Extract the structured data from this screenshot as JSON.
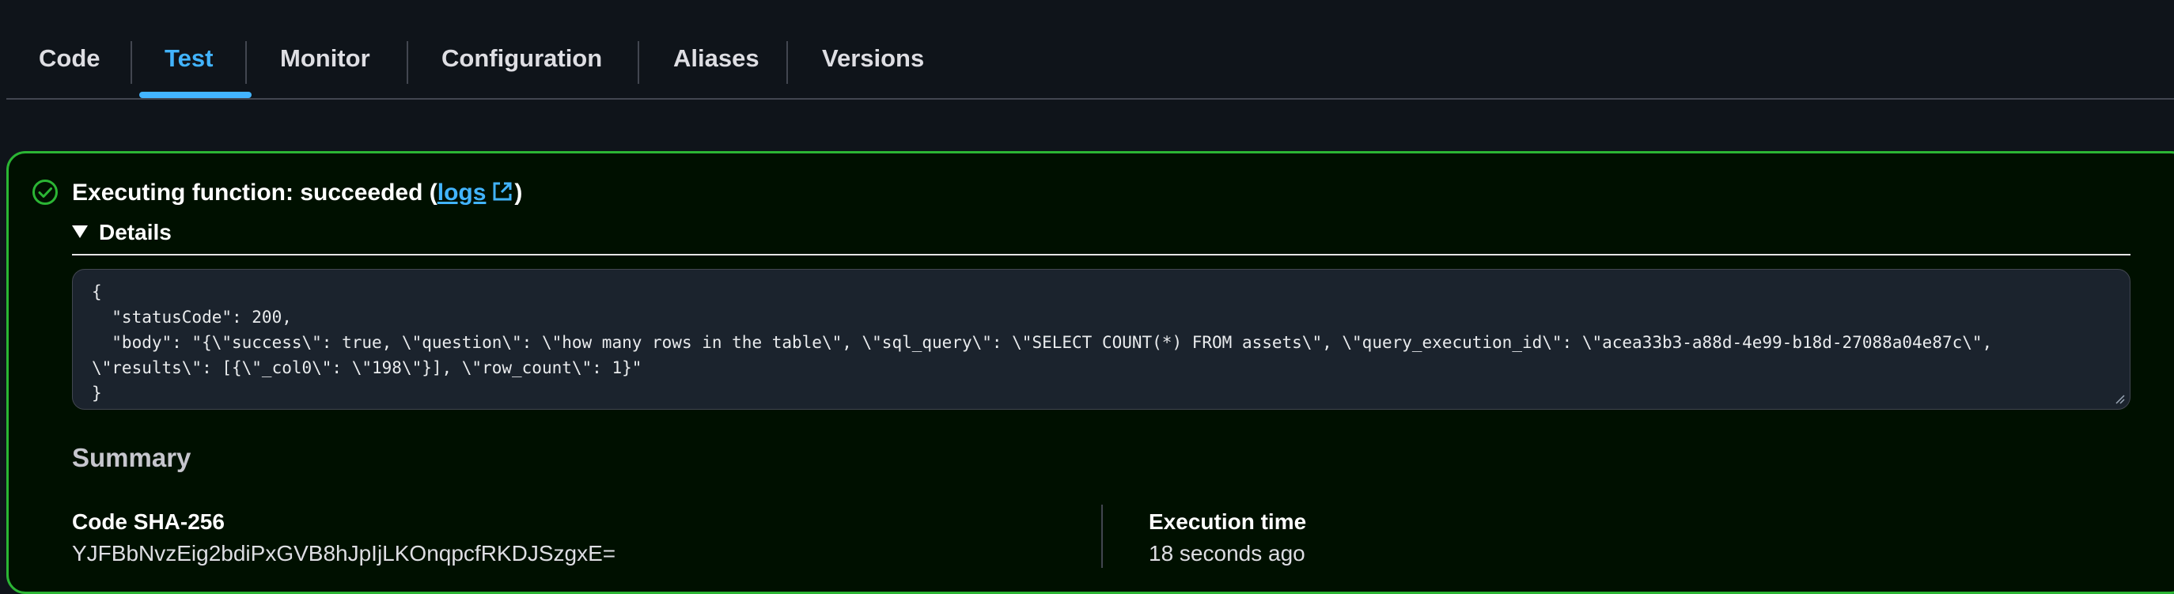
{
  "tabs": [
    {
      "label": "Code"
    },
    {
      "label": "Test"
    },
    {
      "label": "Monitor"
    },
    {
      "label": "Configuration"
    },
    {
      "label": "Aliases"
    },
    {
      "label": "Versions"
    }
  ],
  "active_tab": "Test",
  "result": {
    "status_text": "Executing function: succeeded (",
    "logs_link": "logs",
    "status_close": ")",
    "details_label": "Details",
    "output": "{\n  \"statusCode\": 200,\n  \"body\": \"{\\\"success\\\": true, \\\"question\\\": \\\"how many rows in the table\\\", \\\"sql_query\\\": \\\"SELECT COUNT(*) FROM assets\\\", \\\"query_execution_id\\\": \\\"acea33b3-a88d-4e99-b18d-27088a04e87c\\\",\n\\\"results\\\": [{\\\"_col0\\\": \\\"198\\\"}], \\\"row_count\\\": 1}\"\n}"
  },
  "summary": {
    "heading": "Summary",
    "code_sha_label": "Code SHA-256",
    "code_sha_value": "YJFBbNvzEig2bdiPxGVB8hJpIjLKOnqpcfRKDJSzgxE=",
    "execution_time_label": "Execution time",
    "execution_time_value": "18 seconds ago"
  },
  "colors": {
    "accent": "#42b4ff",
    "success": "#2bb534",
    "background": "#0f141a"
  },
  "icons": [
    "success-check-icon",
    "external-link-icon",
    "caret-down-icon",
    "resize-grip-icon"
  ]
}
